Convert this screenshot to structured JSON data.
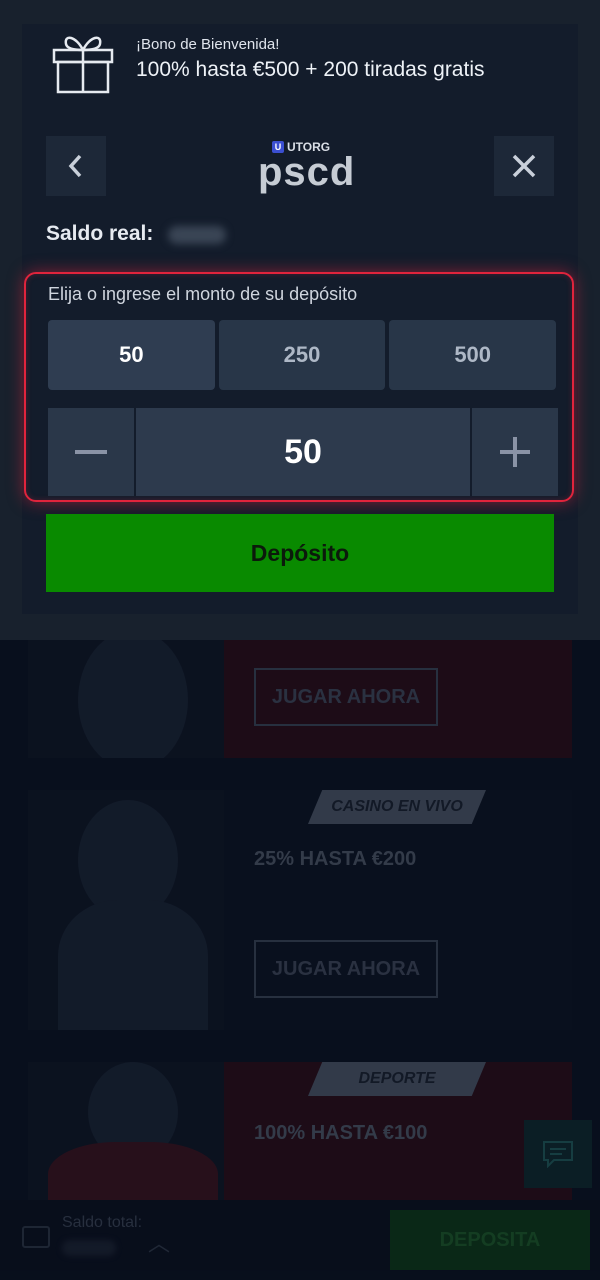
{
  "bonus": {
    "subtitle": "¡Bono de Bienvenida!",
    "title": "100% hasta €500 + 200 tiradas gratis",
    "icon": "gift-icon"
  },
  "header": {
    "back_icon": "chevron-left-icon",
    "close_icon": "close-icon",
    "logo_small": "UTORG",
    "logo_badge": "U",
    "logo_main": "pscd"
  },
  "balance": {
    "label": "Saldo real:",
    "value": "00,00"
  },
  "amount": {
    "title": "Elija o ingrese el monto de su depósito",
    "presets": [
      "50",
      "250",
      "500"
    ],
    "selected": "50",
    "value": "50",
    "minus_icon": "minus-icon",
    "plus_icon": "plus-icon"
  },
  "deposit_button": "Depósito",
  "background": {
    "promos": [
      {
        "tag": "",
        "headline": "",
        "button": "JUGAR AHORA"
      },
      {
        "tag": "CASINO EN VIVO",
        "headline": "25% HASTA €200",
        "button": "JUGAR AHORA"
      },
      {
        "tag": "DEPORTE",
        "headline": "100% HASTA €100",
        "button": ""
      }
    ],
    "bottom_bar": {
      "label": "Saldo total:",
      "value": "00,00",
      "button": "DEPOSITA"
    }
  },
  "colors": {
    "accent_red": "#e0243c",
    "deposit_green": "#098a00",
    "modal_bg": "#131c2b"
  }
}
